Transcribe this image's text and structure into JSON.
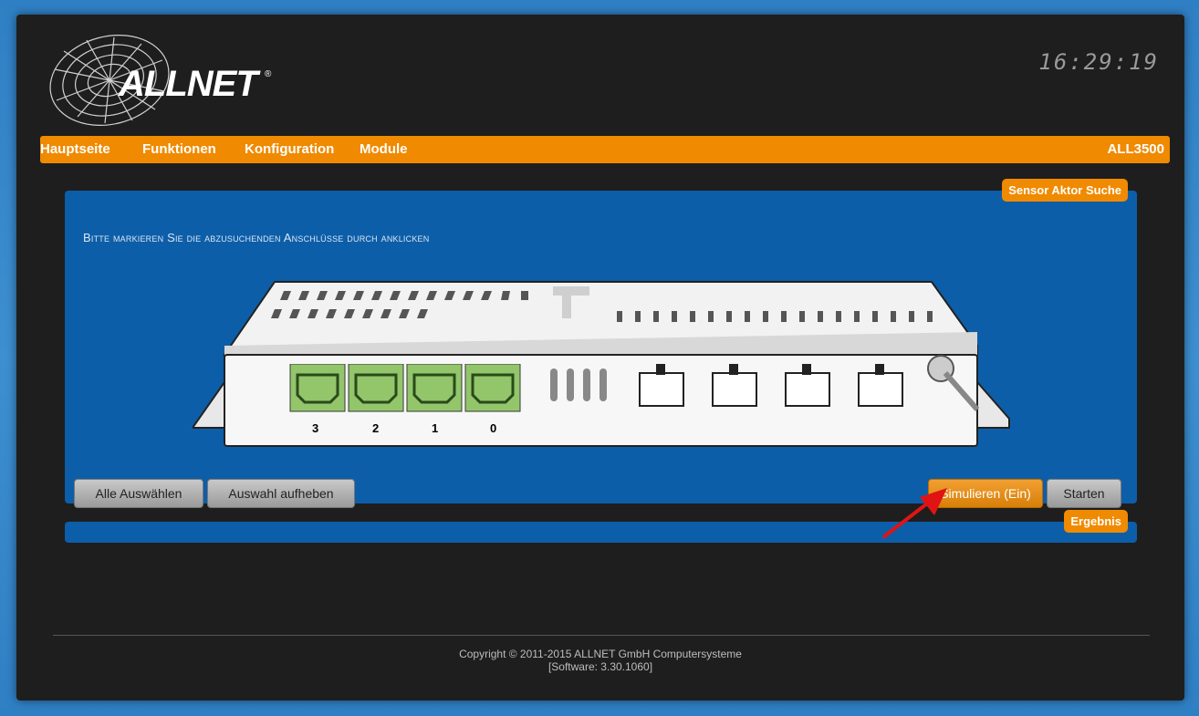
{
  "header": {
    "brand": "ALLNET",
    "brand_mark": "®",
    "clock": "16:29:19"
  },
  "nav": {
    "items": [
      "Hauptseite",
      "Funktionen",
      "Konfiguration",
      "Module"
    ],
    "device_model": "ALL3500"
  },
  "sensor_panel": {
    "tag": "Sensor Aktor Suche",
    "instruction": "Bitte markieren Sie die abzusuchenden Anschlüsse durch anklicken",
    "ports": [
      {
        "label": "3",
        "selected": true
      },
      {
        "label": "2",
        "selected": true
      },
      {
        "label": "1",
        "selected": true
      },
      {
        "label": "0",
        "selected": true
      }
    ],
    "buttons": {
      "select_all": "Alle Auswählen",
      "deselect": "Auswahl aufheben",
      "simulate": "Simulieren (Ein)",
      "start": "Starten"
    }
  },
  "result_panel": {
    "tag": "Ergebnis"
  },
  "footer": {
    "copyright": "Copyright © 2011-2015 ALLNET GmbH Computersysteme",
    "software": "[Software: 3.30.1060]"
  },
  "colors": {
    "accent": "#f08a00",
    "panel": "#0d5ea8",
    "background": "#1e1e1e",
    "port_selected": "#93c56b"
  }
}
